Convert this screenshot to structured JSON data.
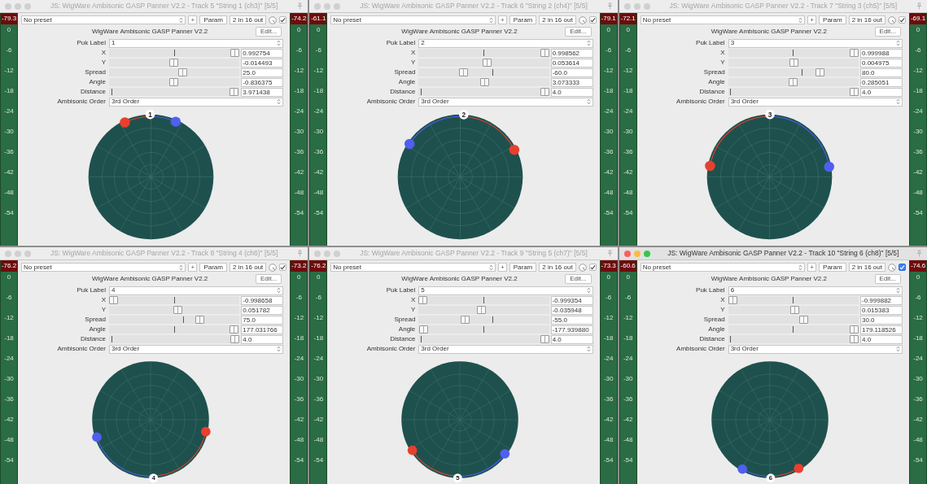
{
  "windows": [
    {
      "title": "JS: WigWare Ambisonic GASP Panner V2.2 - Track 5 \"String 1 (ch3)\" [5/5]",
      "active": false,
      "left_meter": {
        "peak": "-79.3",
        "ticks": [
          "0",
          "-6",
          "-12",
          "-18",
          "-24",
          "-30",
          "-36",
          "-42",
          "-48",
          "-54"
        ]
      },
      "right_meter": {
        "peak": "-74.2",
        "ticks": [
          "0",
          "-6",
          "-12",
          "-18",
          "-24",
          "-30",
          "-36",
          "-42",
          "-48",
          "-54"
        ]
      },
      "preset": "No preset",
      "add_button": "+",
      "param_button": "Param",
      "io_button": "2 in 16 out",
      "enabled_checked": true,
      "plugin_name": "WigWare Ambisonic GASP Panner V2.2",
      "edit_button": "Edit...",
      "puk_label": {
        "label": "Puk Label",
        "value": "1"
      },
      "params": [
        {
          "kind": "x",
          "label": "X",
          "level": 0.996,
          "value": "0.992754"
        },
        {
          "kind": "y",
          "label": "Y",
          "level": 0.493,
          "value": "-0.014493"
        },
        {
          "kind": "spread",
          "label": "Spread",
          "level": 0.569,
          "value": "25.0"
        },
        {
          "kind": "angle",
          "label": "Angle",
          "level": 0.498,
          "value": "-0.836375"
        },
        {
          "kind": "distance",
          "label": "Distance",
          "level": 0.99,
          "value": "3.971438"
        }
      ],
      "order": {
        "label": "Ambisonic Order",
        "value": "3rd Order"
      },
      "puk_number": "1",
      "dots": [
        {
          "color": "#e8402f"
        },
        {
          "color": "#4f5ff0"
        }
      ]
    },
    {
      "title": "JS: WigWare Ambisonic GASP Panner V2.2 - Track 6 \"String 2 (ch4)\" [5/5]",
      "active": false,
      "left_meter": {
        "peak": "-61.1",
        "ticks": [
          "0",
          "-6",
          "-12",
          "-18",
          "-24",
          "-30",
          "-36",
          "-42",
          "-48",
          "-54"
        ]
      },
      "right_meter": {
        "peak": "-79.1",
        "ticks": [
          "0",
          "-6",
          "-12",
          "-18",
          "-24",
          "-30",
          "-36",
          "-42",
          "-48",
          "-54"
        ]
      },
      "preset": "No preset",
      "add_button": "+",
      "param_button": "Param",
      "io_button": "2 in 16 out",
      "enabled_checked": true,
      "plugin_name": "WigWare Ambisonic GASP Panner V2.2",
      "edit_button": "Edit...",
      "puk_label": {
        "label": "Puk Label",
        "value": "2"
      },
      "params": [
        {
          "kind": "x",
          "label": "X",
          "level": 0.999,
          "value": "0.998562"
        },
        {
          "kind": "y",
          "label": "Y",
          "level": 0.527,
          "value": "0.053614"
        },
        {
          "kind": "spread",
          "label": "Spread",
          "level": 0.333,
          "value": "-60.0"
        },
        {
          "kind": "angle",
          "label": "Angle",
          "level": 0.509,
          "value": "3.073333"
        },
        {
          "kind": "distance",
          "label": "Distance",
          "level": 1,
          "value": "4.0"
        }
      ],
      "order": {
        "label": "Ambisonic Order",
        "value": "3rd Order"
      },
      "puk_number": "2",
      "dots": [
        {
          "color": "#e8402f"
        },
        {
          "color": "#4f5ff0"
        }
      ]
    },
    {
      "title": "JS: WigWare Ambisonic GASP Panner V2.2 - Track 7 \"String 3 (ch5)\" [5/5]",
      "active": false,
      "left_meter": {
        "peak": "-72.1",
        "ticks": [
          "0",
          "-6",
          "-12",
          "-18",
          "-24",
          "-30",
          "-36",
          "-42",
          "-48",
          "-54"
        ]
      },
      "right_meter": {
        "peak": "-69.1",
        "ticks": [
          "0",
          "-6",
          "-12",
          "-18",
          "-24",
          "-30",
          "-36",
          "-42",
          "-48",
          "-54"
        ]
      },
      "preset": "No preset",
      "add_button": "+",
      "param_button": "Param",
      "io_button": "2 in 16 out",
      "enabled_checked": true,
      "plugin_name": "WigWare Ambisonic GASP Panner V2.2",
      "edit_button": "Edit...",
      "puk_label": {
        "label": "Puk Label",
        "value": "3"
      },
      "params": [
        {
          "kind": "x",
          "label": "X",
          "level": 1,
          "value": "0.999988"
        },
        {
          "kind": "y",
          "label": "Y",
          "level": 0.502,
          "value": "0.004975"
        },
        {
          "kind": "spread",
          "label": "Spread",
          "level": 0.722,
          "value": "80.0"
        },
        {
          "kind": "angle",
          "label": "Angle",
          "level": 0.501,
          "value": "0.285051"
        },
        {
          "kind": "distance",
          "label": "Distance",
          "level": 1,
          "value": "4.0"
        }
      ],
      "order": {
        "label": "Ambisonic Order",
        "value": "3rd Order"
      },
      "puk_number": "3",
      "dots": [
        {
          "color": "#e8402f"
        },
        {
          "color": "#4f5ff0"
        }
      ]
    },
    {
      "title": "JS: WigWare Ambisonic GASP Panner V2.2 - Track 8 \"String 4 (ch6)\" [5/5]",
      "active": false,
      "left_meter": {
        "peak": "-76.2",
        "ticks": [
          "0",
          "-6",
          "-12",
          "-18",
          "-24",
          "-30",
          "-36",
          "-42",
          "-48",
          "-54"
        ]
      },
      "right_meter": {
        "peak": "-73.2",
        "ticks": [
          "0",
          "-6",
          "-12",
          "-18",
          "-24",
          "-30",
          "-36",
          "-42",
          "-48",
          "-54"
        ]
      },
      "preset": "No preset",
      "add_button": "+",
      "param_button": "Param",
      "io_button": "2 in 16 out",
      "enabled_checked": true,
      "plugin_name": "WigWare Ambisonic GASP Panner V2.2",
      "edit_button": "Edit...",
      "puk_label": {
        "label": "Puk Label",
        "value": "4"
      },
      "params": [
        {
          "kind": "x",
          "label": "X",
          "level": 0.001,
          "value": "-0.998658"
        },
        {
          "kind": "y",
          "label": "Y",
          "level": 0.526,
          "value": "0.051782"
        },
        {
          "kind": "spread",
          "label": "Spread",
          "level": 0.708,
          "value": "75.0"
        },
        {
          "kind": "angle",
          "label": "Angle",
          "level": 0.992,
          "value": "177.031766"
        },
        {
          "kind": "distance",
          "label": "Distance",
          "level": 1,
          "value": "4.0"
        }
      ],
      "order": {
        "label": "Ambisonic Order",
        "value": "3rd Order"
      },
      "puk_number": "4",
      "dots": [
        {
          "color": "#e8402f"
        },
        {
          "color": "#4f5ff0"
        }
      ]
    },
    {
      "title": "JS: WigWare Ambisonic GASP Panner V2.2 - Track 9 \"String 5 (ch7)\" [5/5]",
      "active": false,
      "left_meter": {
        "peak": "-76.2",
        "ticks": [
          "0",
          "-6",
          "-12",
          "-18",
          "-24",
          "-30",
          "-36",
          "-42",
          "-48",
          "-54"
        ]
      },
      "right_meter": {
        "peak": "-73.3",
        "ticks": [
          "0",
          "-6",
          "-12",
          "-18",
          "-24",
          "-30",
          "-36",
          "-42",
          "-48",
          "-54"
        ]
      },
      "preset": "No preset",
      "add_button": "+",
      "param_button": "Param",
      "io_button": "2 in 16 out",
      "enabled_checked": true,
      "plugin_name": "WigWare Ambisonic GASP Panner V2.2",
      "edit_button": "Edit...",
      "puk_label": {
        "label": "Puk Label",
        "value": "5"
      },
      "params": [
        {
          "kind": "x",
          "label": "X",
          "level": 0.0,
          "value": "-0.999354"
        },
        {
          "kind": "y",
          "label": "Y",
          "level": 0.482,
          "value": "-0.035948"
        },
        {
          "kind": "spread",
          "label": "Spread",
          "level": 0.347,
          "value": "-55.0"
        },
        {
          "kind": "angle",
          "label": "Angle",
          "level": 0.006,
          "value": "-177.939880"
        },
        {
          "kind": "distance",
          "label": "Distance",
          "level": 1,
          "value": "4.0"
        }
      ],
      "order": {
        "label": "Ambisonic Order",
        "value": "3rd Order"
      },
      "puk_number": "5",
      "dots": [
        {
          "color": "#e8402f"
        },
        {
          "color": "#4f5ff0"
        }
      ]
    },
    {
      "title": "JS: WigWare Ambisonic GASP Panner V2.2 - Track 10 \"String 6 (ch8)\" [5/5]",
      "active": true,
      "left_meter": {
        "peak": "-60.6",
        "ticks": [
          "0",
          "-6",
          "-12",
          "-18",
          "-24",
          "-30",
          "-36",
          "-42",
          "-48",
          "-54"
        ]
      },
      "right_meter": {
        "peak": "-74.6",
        "ticks": [
          "0",
          "-6",
          "-12",
          "-18",
          "-24",
          "-30",
          "-36",
          "-42",
          "-48",
          "-54"
        ]
      },
      "preset": "No preset",
      "add_button": "+",
      "param_button": "Param",
      "io_button": "2 in 16 out",
      "enabled_checked": true,
      "plugin_name": "WigWare Ambisonic GASP Panner V2.2",
      "edit_button": "Edit...",
      "puk_label": {
        "label": "Puk Label",
        "value": "6"
      },
      "params": [
        {
          "kind": "x",
          "label": "X",
          "level": 0.0,
          "value": "-0.999882"
        },
        {
          "kind": "y",
          "label": "Y",
          "level": 0.508,
          "value": "0.015383"
        },
        {
          "kind": "spread",
          "label": "Spread",
          "level": 0.583,
          "value": "30.0"
        },
        {
          "kind": "angle",
          "label": "Angle",
          "level": 0.998,
          "value": "179.118526"
        },
        {
          "kind": "distance",
          "label": "Distance",
          "level": 1,
          "value": "4.0"
        }
      ],
      "order": {
        "label": "Ambisonic Order",
        "value": "3rd Order"
      },
      "puk_number": "6",
      "dots": [
        {
          "color": "#e8402f"
        },
        {
          "color": "#4f5ff0"
        }
      ]
    }
  ]
}
